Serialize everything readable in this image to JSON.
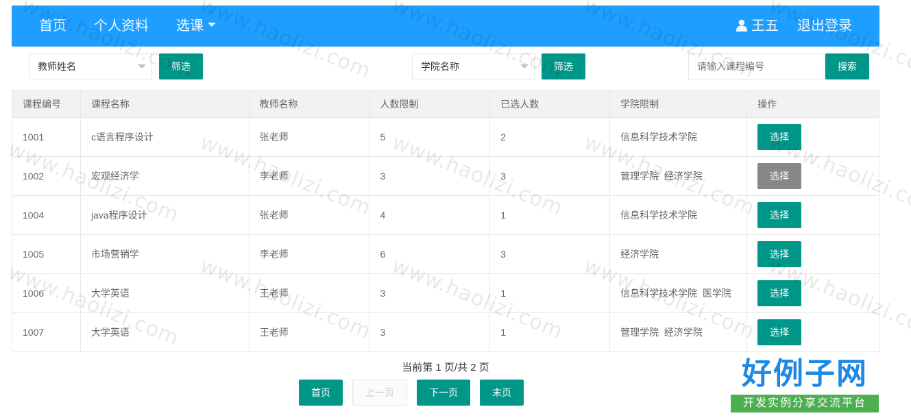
{
  "navbar": {
    "home": "首页",
    "profile": "个人资料",
    "course_select": "选课",
    "user_name": "王五",
    "logout": "退出登录"
  },
  "filters": {
    "teacher_select": "教师姓名",
    "teacher_filter_btn": "筛选",
    "college_select": "学院名称",
    "college_filter_btn": "筛选",
    "search_placeholder": "请输入课程编号",
    "search_btn": "搜索"
  },
  "table": {
    "headers": [
      "课程编号",
      "课程名称",
      "教师名称",
      "人数限制",
      "已选人数",
      "学院限制",
      "操作"
    ],
    "rows": [
      {
        "id": "1001",
        "name": "c语言程序设计",
        "teacher": "张老师",
        "limit": "5",
        "selected": "2",
        "college": "信息科学技术学院",
        "action": "选择",
        "enabled": true
      },
      {
        "id": "1002",
        "name": "宏观经济学",
        "teacher": "李老师",
        "limit": "3",
        "selected": "3",
        "college": "管理学院  经济学院",
        "action": "选择",
        "enabled": false
      },
      {
        "id": "1004",
        "name": "java程序设计",
        "teacher": "张老师",
        "limit": "4",
        "selected": "1",
        "college": "信息科学技术学院",
        "action": "选择",
        "enabled": true
      },
      {
        "id": "1005",
        "name": "市场营销学",
        "teacher": "李老师",
        "limit": "6",
        "selected": "3",
        "college": "经济学院",
        "action": "选择",
        "enabled": true
      },
      {
        "id": "1006",
        "name": "大学英语",
        "teacher": "王老师",
        "limit": "3",
        "selected": "1",
        "college": "信息科学技术学院  医学院",
        "action": "选择",
        "enabled": true
      },
      {
        "id": "1007",
        "name": "大学英语",
        "teacher": "王老师",
        "limit": "3",
        "selected": "1",
        "college": "管理学院  经济学院",
        "action": "选择",
        "enabled": true
      }
    ]
  },
  "pagination": {
    "info": "当前第 1 页/共 2 页",
    "first": "首页",
    "prev": "上一页",
    "next": "下一页",
    "last": "末页"
  },
  "watermark": "www.haolizi.com",
  "logo": {
    "title": "好例子网",
    "subtitle": "开发实例分享交流平台"
  },
  "colors": {
    "navbar": "#1e9fff",
    "primary_button": "#009688",
    "disabled_button": "#888888",
    "logo_title": "#1e88e5",
    "logo_subtitle_bg": "#4caf50"
  }
}
